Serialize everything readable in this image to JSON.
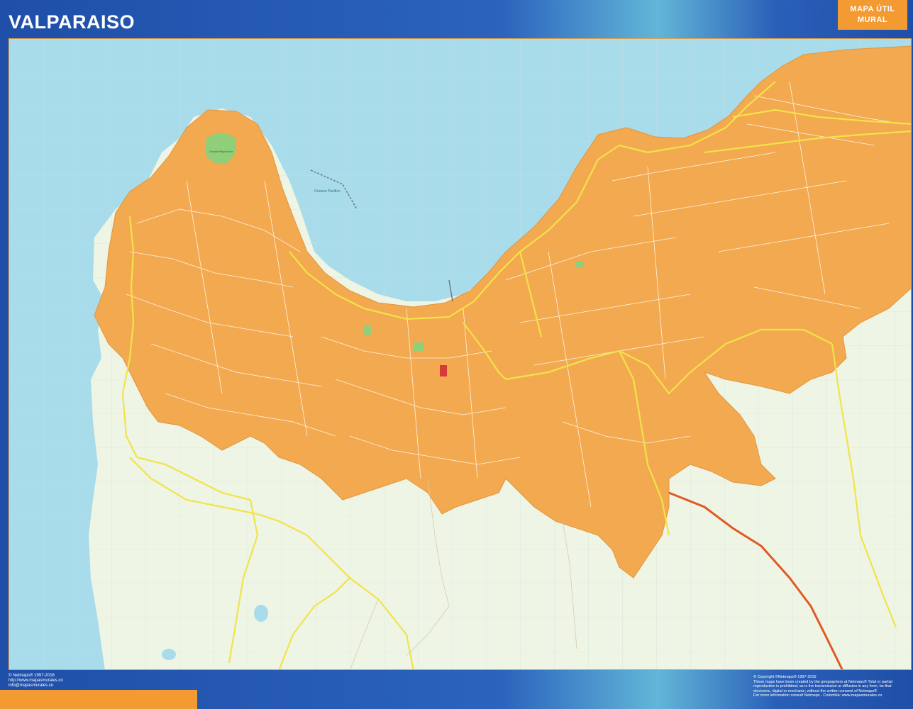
{
  "header": {
    "title": "VALPARAISO",
    "badge_line1": "MAPA ÚTIL",
    "badge_line2": "MURAL"
  },
  "map": {
    "colors": {
      "sea": "#a9dcea",
      "land": "#eef5e4",
      "urban": "#f3a94f",
      "park": "#8fcf7a",
      "main_road": "#f2e34a",
      "highway": "#e05a22",
      "street": "#ffffff"
    },
    "labels": {
      "ocean": "Océano Pacífico",
      "park": "Cerrado Playa Ancha"
    }
  },
  "footer": {
    "left_lines": [
      "© Netmaps® 1997-2016",
      "http://www.mapasmurales.co",
      "info@mapasmurales.co"
    ],
    "right_lines": [
      "© Copyright ©Netmaps® 1997-2016",
      "These maps have been created by the geographers at Netmaps® Total or partial",
      "reproduction is prohibited; as is the transmission or diffusion in any form, be that",
      "electronic, digital or mechanic; without the written consent of Netmaps®",
      "For more information consult Netmaps - Colombia: www.mapasmurales.co"
    ]
  }
}
